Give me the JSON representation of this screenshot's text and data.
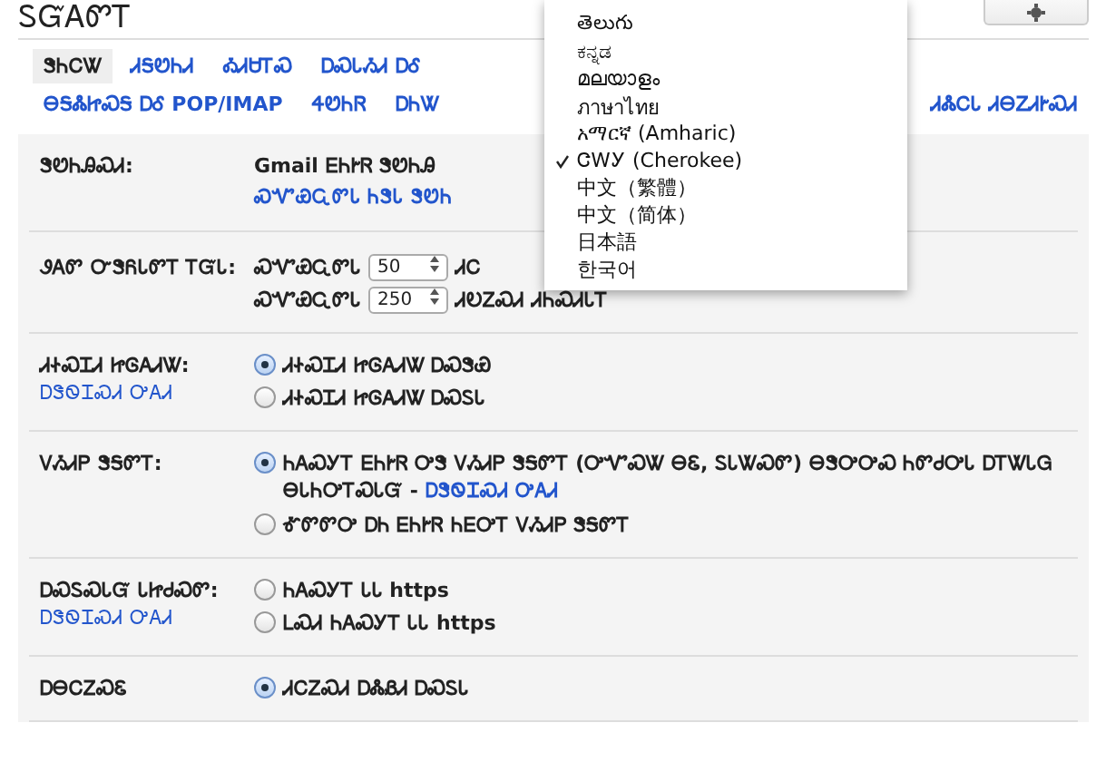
{
  "header": {
    "title": "ᏚᏳᎪᏛᎢ"
  },
  "tab_rows": [
    [
      {
        "label": "ᏕᏂᏟᏔ",
        "selected": true
      },
      {
        "label": "ᏗᎦᏬᏂᏗ",
        "selected": false
      },
      {
        "label": "ᎣᏗᏌᎢᏍ",
        "selected": false
      },
      {
        "label": "ᎠᏍᏓᏱᏗ ᎠᎴ",
        "selected": false
      }
    ],
    [
      {
        "label": "ᎾᎦᏜᏥᏍᎦ ᎠᎴ POP/IMAP",
        "selected": false
      },
      {
        "label": "ᏎᏬᏂᏒ",
        "selected": false
      },
      {
        "label": "ᎠᏂᏔ",
        "selected": false
      },
      {
        "label": "ᏗᏜᏟᏓ ᏗᎾᏃᏗᎨᏍᏗ",
        "selected": false
      }
    ]
  ],
  "language_menu": [
    {
      "label": "తెలుగు",
      "selected": false
    },
    {
      "label": "ಕನ್ನಡ",
      "selected": false
    },
    {
      "label": "മലയാളം",
      "selected": false
    },
    {
      "label": "ภาษาไทย",
      "selected": false
    },
    {
      "label": "አማርኛ (Amharic)",
      "selected": false
    },
    {
      "label": "ᏣᎳᎩ (Cherokee)",
      "selected": true
    },
    {
      "label": "中文（繁體）",
      "selected": false
    },
    {
      "label": "中文（简体）",
      "selected": false
    },
    {
      "label": "日本語",
      "selected": false
    },
    {
      "label": "한국어",
      "selected": false
    }
  ],
  "settings": [
    {
      "label": "ᏕᏬᏂᎯᏍᏗ:",
      "lines": [
        {
          "kind": "text",
          "text": "Gmail ᎬᏂᎨᏒ ᏕᏬᏂᎯ"
        },
        {
          "kind": "link",
          "text": "ᏍᏉᏯᏩᏛᏓ ᏂᏕᏓ ᏕᏬᏂ"
        }
      ]
    },
    {
      "label": "ᏭᎪᏛ ᏅᏕᏲᏓᏛᎢ ᎢᏳᏓ:",
      "lines": [
        {
          "kind": "select",
          "prefix": "ᏍᏉᏯᏩᏛᏓ",
          "value": "50",
          "suffix": "ᏗᏟ"
        },
        {
          "kind": "select",
          "prefix": "ᏍᏉᏯᏩᏛᏓ",
          "value": "250",
          "suffix": "ᏗᎧᏃᏍᏗ ᏗᏂᏍᏗᏓᎢ"
        }
      ]
    },
    {
      "label": "ᏗᏐᏍᏆᏗ ᏥᎶᎪᏗᏔ:",
      "link": "ᎠᏕᏫᏆᏍᏗ ᎤᎪᏗ",
      "lines": [
        {
          "kind": "radio",
          "selected": true,
          "text": "ᏗᏐᏍᏆᏗ ᏥᎶᎪᏗᏔ ᎠᏍᏕᏯ"
        },
        {
          "kind": "radio",
          "selected": false,
          "text": "ᏗᏐᏍᏆᏗ ᏥᎶᎪᏗᏔ ᎠᏍᏚᏓ"
        }
      ]
    },
    {
      "label": "ᏙᏱᏗᏢ ᏕᎦᏛᎢ:",
      "lines": [
        {
          "kind": "radio",
          "selected": true,
          "text": "ᏂᎪᏍᎩᎢ ᎬᏂᎨᏒ ᎤᏕ ᏙᏱᏗᏢ ᏕᎦᏛᎢ (ᎤᏉᏍᏔ ᎾᏋ, ᏚᏓᏔᏍᏛ) ᎾᏕᎤᎤᏍ ᏂᏛᏧᎤᏓ ᎠᎢᏔᏓᏀ ᎾᏓᏂᎤᎢᏍᏓᏳ -",
          "link": "ᎠᏕᏫᏆᏍᏗ ᎤᎪᏗ"
        },
        {
          "kind": "radio",
          "selected": false,
          "text": "ᎹᏛᏛᎤ ᎠᏂ ᎬᏂᎨᏒ ᏂᎬᎤᎢ ᏙᏱᏗᏢ ᏕᎦᏛᎢ"
        }
      ]
    },
    {
      "label": "ᎠᏍᏚᏍᏓᏳ ᏓᏥᏧᏍᏛ:",
      "link": "ᎠᏕᏫᏆᏍᏗ ᎤᎪᏗ",
      "lines": [
        {
          "kind": "radio",
          "selected": false,
          "text": "ᏂᎪᏍᎩᎢ ᏓᏓ https"
        },
        {
          "kind": "radio",
          "selected": false,
          "text": "ᏞᏍᏗ ᏂᎪᏍᎩᎢ ᏓᏓ https"
        }
      ]
    },
    {
      "label": "ᎠᎾᏟᏃᏍᏋ",
      "lines": [
        {
          "kind": "radio",
          "selected": true,
          "text": "ᏗᏟᏃᏍᏗ ᎠᏜᏰᏗ ᎠᏍᏚᏓ"
        }
      ]
    }
  ]
}
